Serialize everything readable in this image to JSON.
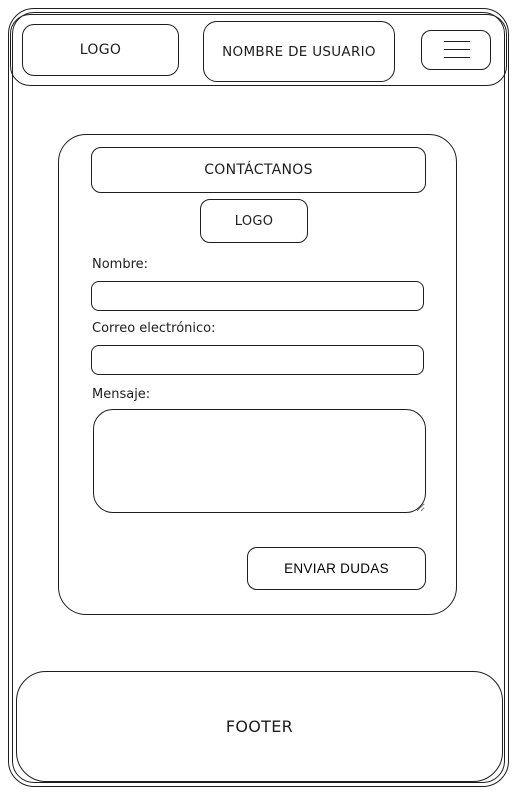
{
  "header": {
    "logo_label": "LOGO",
    "username_label": "NOMBRE DE USUARIO",
    "menu_icon": "hamburger-menu-icon"
  },
  "contact": {
    "title": "CONTÁCTANOS",
    "logo_label": "LOGO",
    "name_label": "Nombre:",
    "name_value": "",
    "email_label": "Correo electrónico:",
    "email_value": "",
    "message_label": "Mensaje:",
    "message_value": "",
    "submit_label": "ENVIAR DUDAS"
  },
  "footer": {
    "label": "FOOTER"
  },
  "colors": {
    "stroke": "#1e1e1e",
    "background": "#ffffff"
  }
}
